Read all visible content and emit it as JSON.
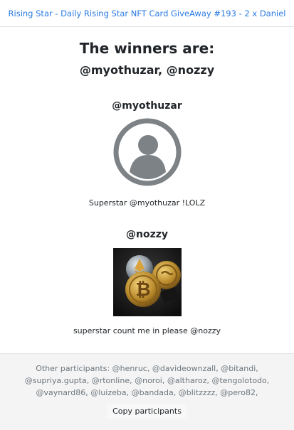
{
  "header": {
    "title_link": "Rising Star - Daily Rising Star NFT Card GiveAway #193 - 2 x Daniel"
  },
  "main": {
    "headline": "The winners are:",
    "winners_line": "@myothuzar, @nozzy",
    "winners": [
      {
        "name": "@myothuzar",
        "avatar": "default-user-avatar-icon",
        "comment": "Superstar @myothuzar !LOLZ"
      },
      {
        "name": "@nozzy",
        "avatar": "crypto-coins-avatar",
        "comment": "superstar count me in please @nozzy"
      }
    ]
  },
  "footer": {
    "participants_text": "Other participants: @henruc, @davideownzall, @bitandi, @supriya.gupta, @rtonline, @noroi, @altharoz, @tengolotodo, @vaynard86, @luizeba, @bandada, @blitzzzz, @pero82,",
    "copy_button": "Copy participants"
  },
  "colors": {
    "link": "#2a7ae2",
    "avatar_grey": "#7d8287",
    "footer_bg": "#f4f4f4"
  }
}
